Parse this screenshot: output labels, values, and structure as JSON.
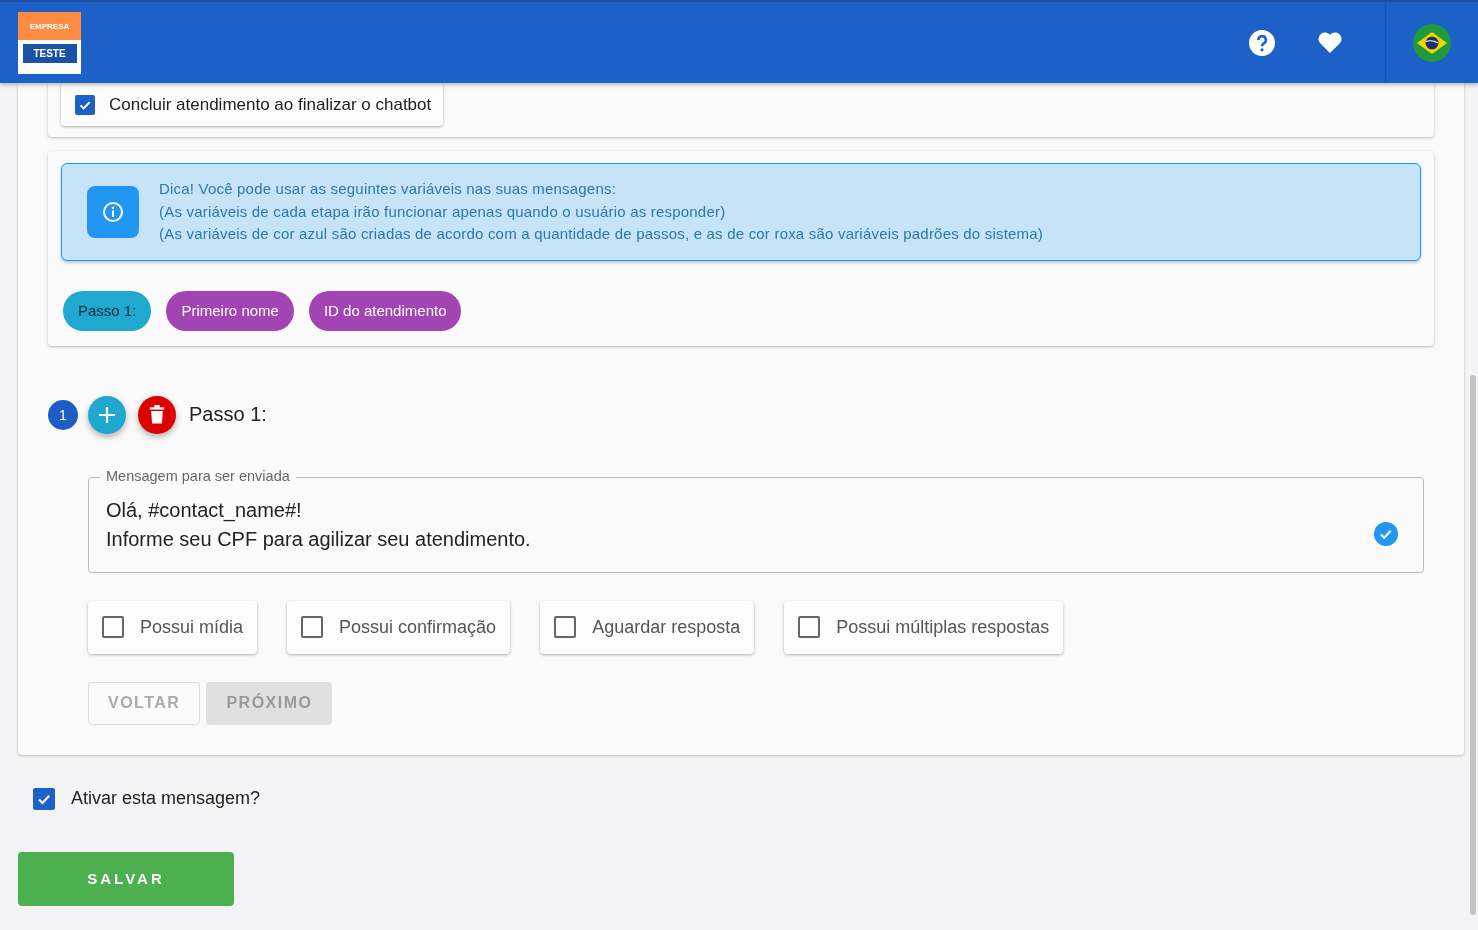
{
  "header": {
    "logo": {
      "top": "EMPRESA",
      "bottom": "TESTE"
    }
  },
  "finish_option": {
    "label": "Concluir atendimento ao finalizar o chatbot",
    "checked": true
  },
  "tip": {
    "lines": [
      "Dica! Você pode usar as seguintes variáveis nas suas mensagens:",
      "(As variáveis de cada etapa irão funcionar apenas quando o usuário as responder)",
      "(As variáveis de cor azul são criadas de acordo com a quantidade de passos, e as de cor roxa são variáveis padrões do sistema)"
    ]
  },
  "variables": [
    {
      "label": "Passo 1:",
      "color": "#1fa8d0"
    },
    {
      "label": "Primeiro nome",
      "color": "#a245b3"
    },
    {
      "label": "ID do atendimento",
      "color": "#a245b3"
    }
  ],
  "step": {
    "number": "1",
    "title": "Passo 1:",
    "message": {
      "label": "Mensagem para ser enviada",
      "value": "Olá, #contact_name#!\nInforme seu CPF para agilizar seu atendimento.",
      "valid": true
    },
    "options": [
      {
        "label": "Possui mídia",
        "checked": false
      },
      {
        "label": "Possui confirmação",
        "checked": false
      },
      {
        "label": "Aguardar resposta",
        "checked": false
      },
      {
        "label": "Possui múltiplas respostas",
        "checked": false
      }
    ],
    "buttons": [
      {
        "label": "VOLTAR",
        "kind": "outlined",
        "disabled": true
      },
      {
        "label": "PRÓXIMO",
        "kind": "contained",
        "disabled": true
      }
    ]
  },
  "active_option": {
    "label": "Ativar esta mensagem?",
    "checked": true
  },
  "save_button": {
    "label": "SALVAR"
  }
}
